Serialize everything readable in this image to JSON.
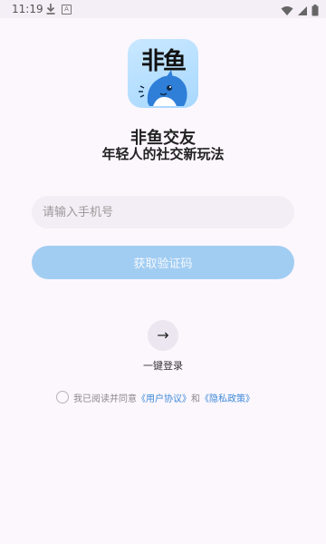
{
  "status_bar": {
    "time": "11:19",
    "icons": [
      "download-icon",
      "a-icon",
      "wifi-icon",
      "signal-icon",
      "battery-icon"
    ]
  },
  "app": {
    "logo_text": "非鱼",
    "name": "非鱼交友",
    "slogan": "年轻人的社交新玩法"
  },
  "login": {
    "phone_placeholder": "请输入手机号",
    "get_code_label": "获取验证码",
    "onekey_icon": "→",
    "onekey_label": "一键登录"
  },
  "agreement": {
    "prefix": "我已阅读并同意",
    "user_agreement": "《用户协议》",
    "and": "和",
    "privacy_policy": "《隐私政策》"
  },
  "colors": {
    "background": "#fcf7fd",
    "button": "#a2cdf2",
    "link": "#3d8ad8"
  }
}
